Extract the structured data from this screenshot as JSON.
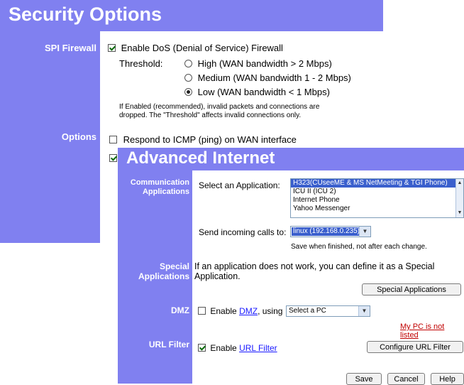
{
  "security": {
    "title": "Security Options",
    "spi_label": "SPI Firewall",
    "dos_label": "Enable DoS (Denial of Service) Firewall",
    "dos_checked": true,
    "threshold_label": "Threshold:",
    "thresholds": [
      {
        "label": "High (WAN bandwidth > 2 Mbps)",
        "selected": false
      },
      {
        "label": "Medium (WAN bandwidth 1 - 2 Mbps)",
        "selected": false
      },
      {
        "label": "Low (WAN bandwidth < 1 Mbps)",
        "selected": true
      }
    ],
    "note_line1": "If Enabled (recommended), invalid packets and connections are",
    "note_line2": "dropped. The \"Threshold\" affects invalid connections only.",
    "options_label": "Options",
    "icmp_label": "Respond to ICMP (ping) on WAN interface",
    "icmp_checked": false,
    "hidden_checkboxes": [
      true,
      true,
      true,
      false
    ]
  },
  "advanced": {
    "title": "Advanced Internet",
    "comm_label_1": "Communication",
    "comm_label_2": "Applications",
    "select_app_label": "Select an Application:",
    "apps": [
      {
        "label": "H323(CUseeME & MS NetMeeting & TGI Phone)",
        "selected": true
      },
      {
        "label": "ICU II (ICU 2)",
        "selected": false
      },
      {
        "label": "Internet Phone",
        "selected": false
      },
      {
        "label": "Yahoo Messenger",
        "selected": false
      }
    ],
    "send_calls_label": "Send incoming calls to:",
    "send_calls_value": "linux (192.168.0.235)",
    "save_note": "Save when finished, not after each change.",
    "special_label_1": "Special",
    "special_label_2": "Applications",
    "special_text_1": "If an application does not work, you can define it as a Special",
    "special_text_2": "Application.",
    "special_button": "Special Applications",
    "dmz_label": "DMZ",
    "dmz_checked": false,
    "dmz_enable": "Enable",
    "dmz_link": "DMZ",
    "dmz_using": ", using",
    "dmz_select": "Select a PC",
    "my_pc_link": "My PC is not listed",
    "url_label": "URL Filter",
    "url_checked": true,
    "url_enable": "Enable",
    "url_link": "URL Filter",
    "url_button": "Configure URL Filter",
    "save_button": "Save",
    "cancel_button": "Cancel",
    "help_button": "Help"
  },
  "colors": {
    "header": "#8080f0",
    "link": "#1a1aff",
    "red_link": "#c00000",
    "selection": "#3a5fcd"
  }
}
